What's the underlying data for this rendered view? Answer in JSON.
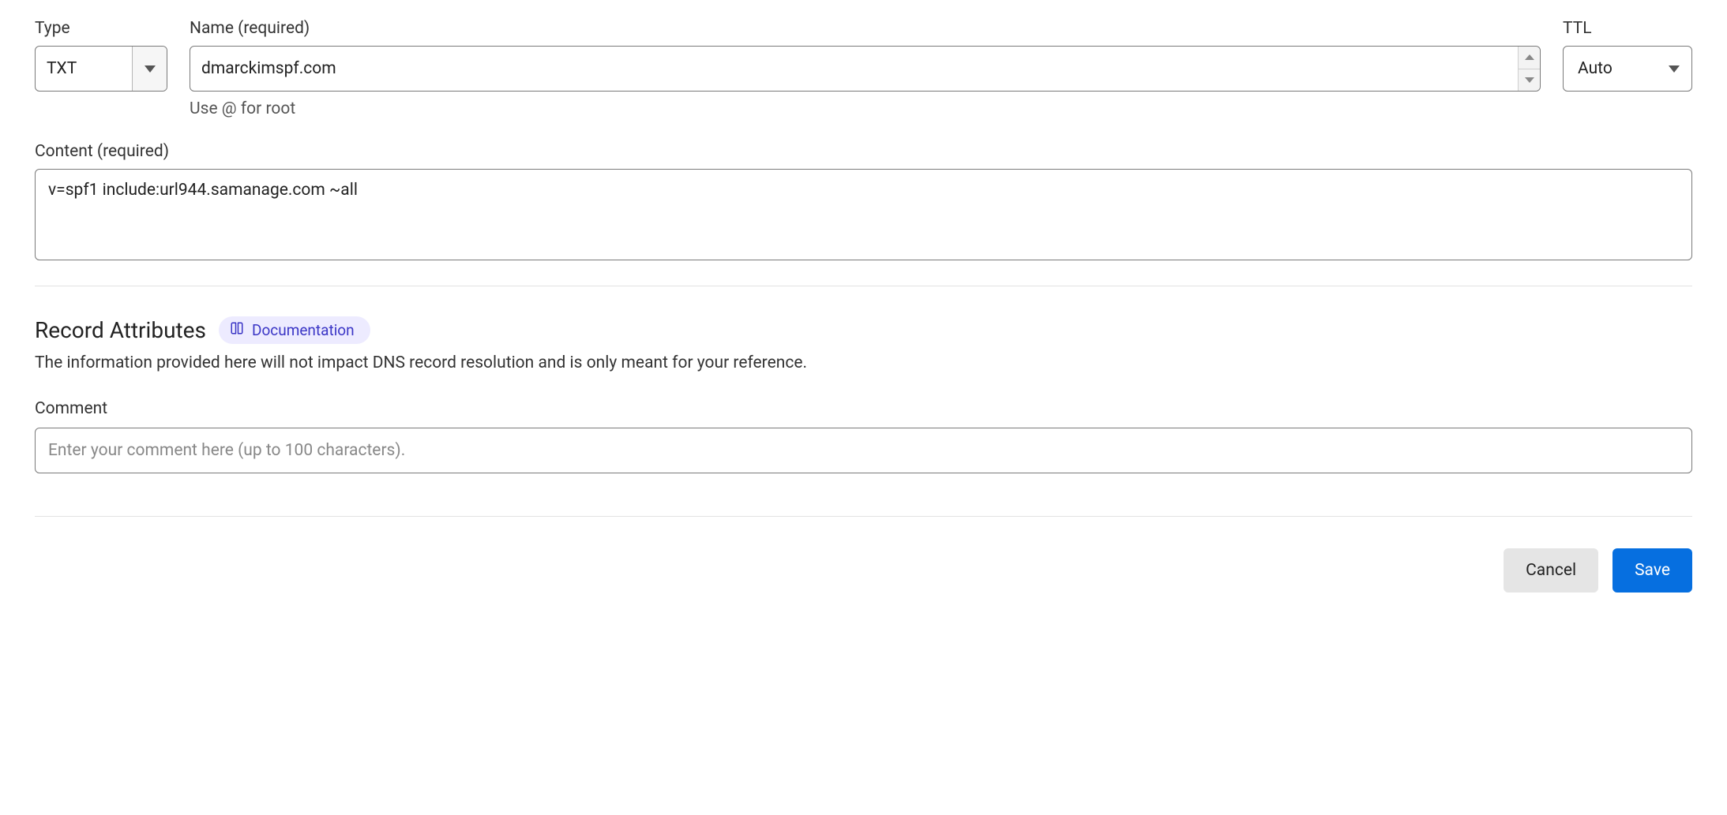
{
  "fields": {
    "type": {
      "label": "Type",
      "value": "TXT"
    },
    "name": {
      "label": "Name (required)",
      "value": "dmarckimspf.com",
      "help": "Use @ for root"
    },
    "ttl": {
      "label": "TTL",
      "value": "Auto"
    },
    "content": {
      "label": "Content (required)",
      "value": "v=spf1 include:url944.samanage.com ~all"
    },
    "comment": {
      "label": "Comment",
      "placeholder": "Enter your comment here (up to 100 characters).",
      "value": ""
    }
  },
  "record_attributes": {
    "title": "Record Attributes",
    "doc_link": "Documentation",
    "description": "The information provided here will not impact DNS record resolution and is only meant for your reference."
  },
  "actions": {
    "cancel": "Cancel",
    "save": "Save"
  }
}
